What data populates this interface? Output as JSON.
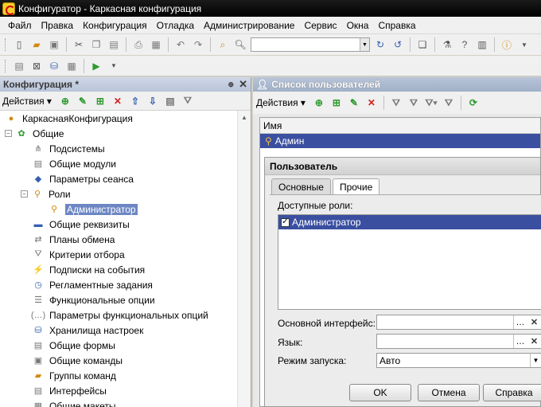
{
  "window": {
    "title": "Конфигуратор - Каркасная конфигурация"
  },
  "menu": [
    {
      "label": "Файл"
    },
    {
      "label": "Правка"
    },
    {
      "label": "Конфигурация"
    },
    {
      "label": "Отладка"
    },
    {
      "label": "Администрирование"
    },
    {
      "label": "Сервис"
    },
    {
      "label": "Окна"
    },
    {
      "label": "Справка"
    }
  ],
  "left_panel": {
    "title": "Конфигурация *",
    "actions_label": "Действия",
    "tree": [
      {
        "label": "КаркаснаяКонфигурация",
        "icon": "config-root-icon"
      },
      {
        "label": "Общие",
        "icon": "common-icon"
      },
      {
        "label": "Подсистемы",
        "icon": "subsystems-icon"
      },
      {
        "label": "Общие модули",
        "icon": "module-icon"
      },
      {
        "label": "Параметры сеанса",
        "icon": "session-param-icon"
      },
      {
        "label": "Роли",
        "icon": "role-icon"
      },
      {
        "label": "Администратор",
        "icon": "role-icon"
      },
      {
        "label": "Общие реквизиты",
        "icon": "attribute-icon"
      },
      {
        "label": "Планы обмена",
        "icon": "exchange-plan-icon"
      },
      {
        "label": "Критерии отбора",
        "icon": "filter-criteria-icon"
      },
      {
        "label": "Подписки на события",
        "icon": "event-subscription-icon"
      },
      {
        "label": "Регламентные задания",
        "icon": "scheduled-job-icon"
      },
      {
        "label": "Функциональные опции",
        "icon": "functional-option-icon"
      },
      {
        "label": "Параметры функциональных опций",
        "icon": "functional-param-icon"
      },
      {
        "label": "Хранилища настроек",
        "icon": "settings-storage-icon"
      },
      {
        "label": "Общие формы",
        "icon": "form-icon"
      },
      {
        "label": "Общие команды",
        "icon": "command-icon"
      },
      {
        "label": "Группы команд",
        "icon": "command-group-icon"
      },
      {
        "label": "Интерфейсы",
        "icon": "interface-icon"
      },
      {
        "label": "Общие макеты",
        "icon": "template-icon"
      }
    ]
  },
  "users": {
    "title": "Список пользователей",
    "actions_label": "Действия",
    "column_name": "Имя",
    "rows": [
      "Админ"
    ]
  },
  "dialog": {
    "title": "Пользователь",
    "tabs": [
      "Основные",
      "Прочие"
    ],
    "roles_label": "Доступные роли:",
    "roles": [
      {
        "label": "Администратор",
        "checked": true
      }
    ],
    "main_interface_label": "Основной интерфейс:",
    "main_interface_value": "",
    "language_label": "Язык:",
    "language_value": "",
    "launch_mode_label": "Режим запуска:",
    "launch_mode_value": "Авто",
    "ok_label": "OK",
    "cancel_label": "Отмена",
    "help_label": "Справка"
  }
}
